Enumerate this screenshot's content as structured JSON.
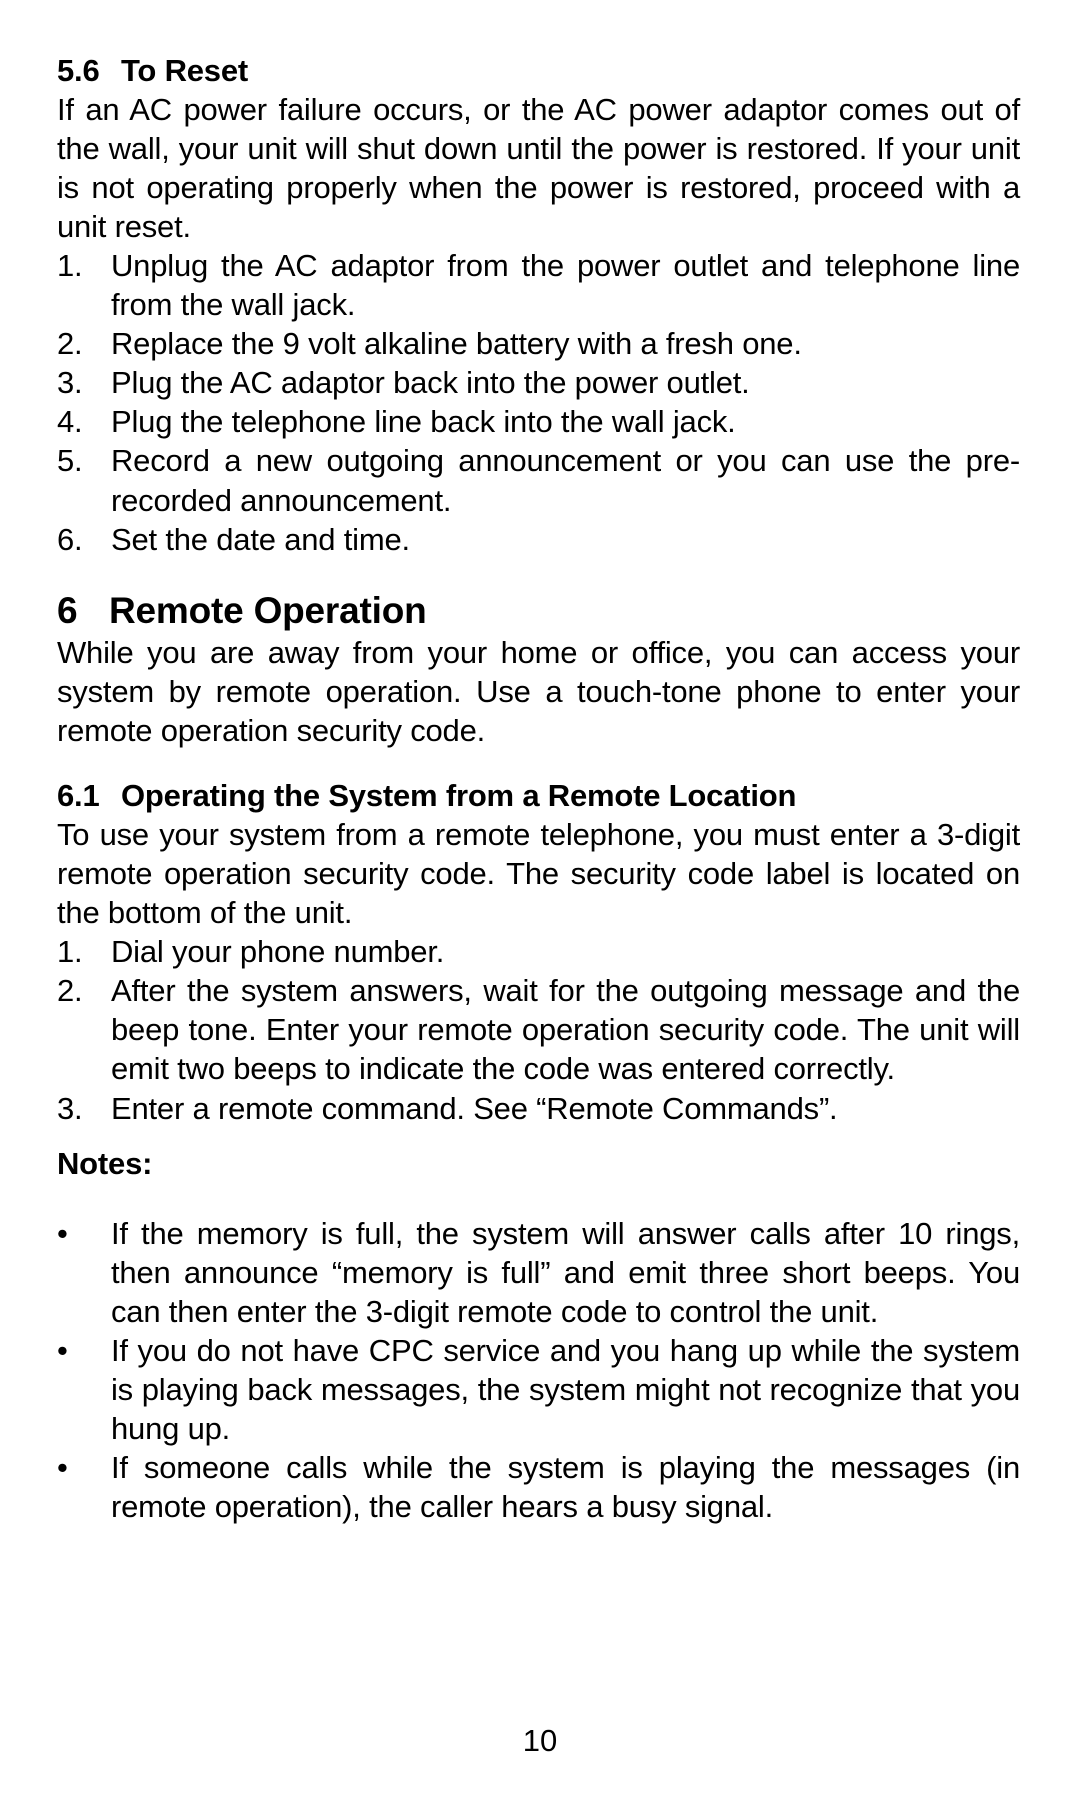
{
  "sec56": {
    "number": "5.6",
    "title": "To Reset",
    "intro": "If an AC power failure occurs, or the AC power adaptor comes out of the wall, your unit will shut down until the power is restored. If your unit is not operating properly when the power is restored, proceed with a unit reset.",
    "steps": [
      "Unplug the AC adaptor from the power outlet and telephone line from the wall jack.",
      "Replace the 9 volt alkaline battery with a fresh one.",
      "Plug the AC adaptor back into the power outlet.",
      "Plug the telephone line back into the wall jack.",
      "Record a new outgoing announcement or you can use the pre-recorded announcement.",
      "Set the date and time."
    ]
  },
  "sec6": {
    "number": "6",
    "title": "Remote Operation",
    "intro": "While you are away from your home or office, you can access your system by remote operation. Use a touch-tone phone to enter your remote operation security code."
  },
  "sec61": {
    "number": "6.1",
    "title": "Operating the System from a Remote Location",
    "intro": "To use your system from a remote telephone, you must enter a 3-digit remote operation security code. The security code label is located on the bottom of the unit.",
    "steps": [
      "Dial your phone number.",
      "After the system answers, wait for the outgoing message and the beep tone. Enter your remote operation security code. The unit will emit two beeps to indicate the code was entered correctly.",
      "Enter a remote command. See “Remote Commands”."
    ],
    "notes_label": "Notes:",
    "notes": [
      "If the memory is full, the system will answer calls after 10 rings, then announce “memory is full” and emit three short beeps. You can then enter the 3-digit remote code to control the unit.",
      "If you do not have CPC service and you hang up while the system is playing back messages, the system might not recognize that you hung up.",
      "If someone calls while the system is playing the messages (in remote operation), the caller hears a busy signal."
    ]
  },
  "page_number": "10",
  "markers": {
    "n1": "1.",
    "n2": "2.",
    "n3": "3.",
    "n4": "4.",
    "n5": "5.",
    "n6": "6.",
    "bullet": "•"
  }
}
